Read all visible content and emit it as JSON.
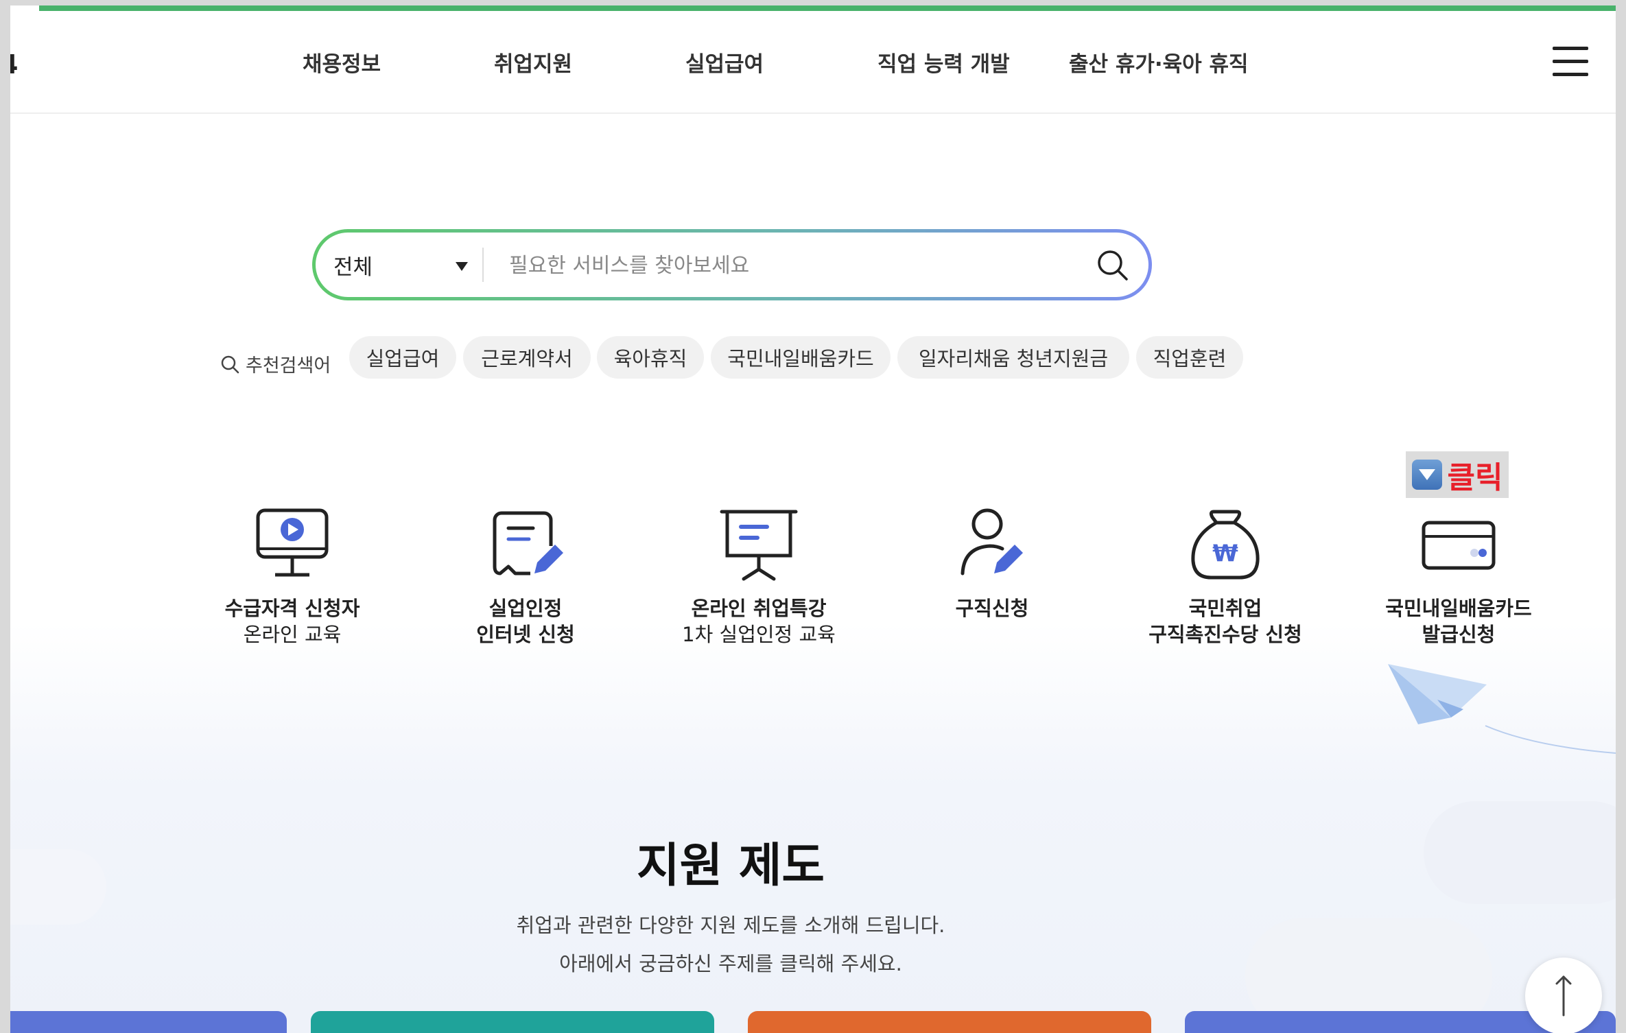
{
  "header": {
    "logo_fragment": "4",
    "nav": [
      "채용정보",
      "취업지원",
      "실업급여",
      "직업 능력 개발",
      "출산 휴가·육아 휴직"
    ]
  },
  "search": {
    "category": "전체",
    "placeholder": "필요한 서비스를 찾아보세요",
    "value": ""
  },
  "recommended": {
    "label": "추천검색어",
    "keywords": [
      "실업급여",
      "근로계약서",
      "육아휴직",
      "국민내일배움카드",
      "일자리채움 청년지원금",
      "직업훈련"
    ]
  },
  "services": [
    {
      "line1": "수급자격 신청자",
      "line2": "온라인 교육",
      "icon": "monitor-play-icon"
    },
    {
      "line1": "실업인정",
      "line2": "인터넷 신청",
      "icon": "document-edit-icon"
    },
    {
      "line1": "온라인 취업특강",
      "line2": "1차 실업인정 교육",
      "icon": "presentation-board-icon"
    },
    {
      "line1": "구직신청",
      "line2": "",
      "icon": "person-edit-icon"
    },
    {
      "line1": "국민취업",
      "line2": "구직촉진수당 신청",
      "icon": "money-bag-icon"
    },
    {
      "line1": "국민내일배움카드",
      "line2": "발급신청",
      "icon": "card-icon"
    }
  ],
  "annotation": {
    "text": "클릭",
    "icon": "down-arrow-box-icon"
  },
  "support": {
    "title": "지원 제도",
    "desc1": "취업과 관련한 다양한 지원 제도를 소개해 드립니다.",
    "desc2": "아래에서 궁금하신 주제를 클릭해 주세요."
  },
  "colors": {
    "accent_green": "#49b26b",
    "accent_blue": "#4a67d6",
    "annotation_red": "#e8202a",
    "card_colors": [
      "#5c74d6",
      "#1fa39a",
      "#e0682e",
      "#5c74d6"
    ]
  }
}
